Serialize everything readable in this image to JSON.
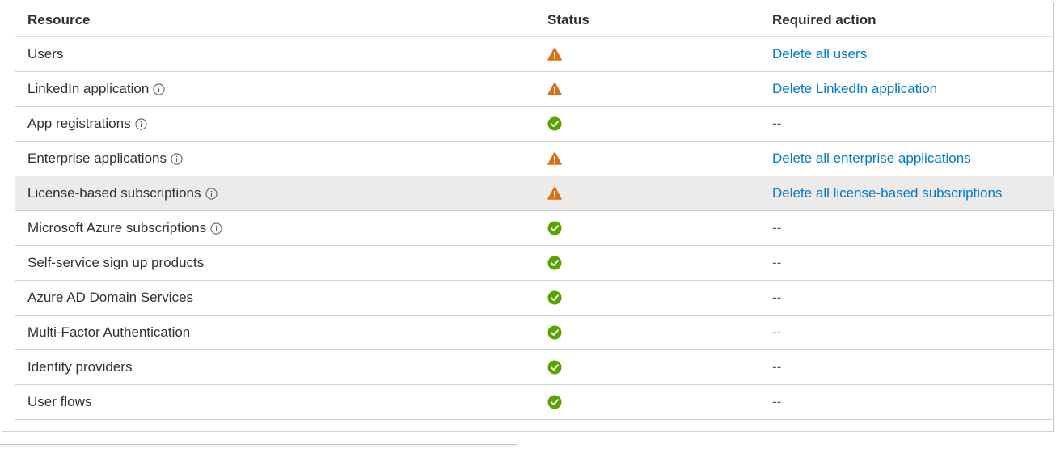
{
  "table": {
    "headers": {
      "resource": "Resource",
      "status": "Status",
      "action": "Required action"
    },
    "rows": [
      {
        "resource": "Users",
        "info": false,
        "status": "warning",
        "action": "Delete all users",
        "action_is_link": true
      },
      {
        "resource": "LinkedIn application",
        "info": true,
        "status": "warning",
        "action": "Delete LinkedIn application",
        "action_is_link": true
      },
      {
        "resource": "App registrations",
        "info": true,
        "status": "ok",
        "action": "--",
        "action_is_link": false
      },
      {
        "resource": "Enterprise applications",
        "info": true,
        "status": "warning",
        "action": "Delete all enterprise applications",
        "action_is_link": true
      },
      {
        "resource": "License-based subscriptions",
        "info": true,
        "status": "warning",
        "action": "Delete all license-based subscriptions",
        "action_is_link": true,
        "highlighted": true
      },
      {
        "resource": "Microsoft Azure subscriptions",
        "info": true,
        "status": "ok",
        "action": "--",
        "action_is_link": false
      },
      {
        "resource": "Self-service sign up products",
        "info": false,
        "status": "ok",
        "action": "--",
        "action_is_link": false
      },
      {
        "resource": "Azure AD Domain Services",
        "info": false,
        "status": "ok",
        "action": "--",
        "action_is_link": false
      },
      {
        "resource": "Multi-Factor Authentication",
        "info": false,
        "status": "ok",
        "action": "--",
        "action_is_link": false
      },
      {
        "resource": "Identity providers",
        "info": false,
        "status": "ok",
        "action": "--",
        "action_is_link": false
      },
      {
        "resource": "User flows",
        "info": false,
        "status": "ok",
        "action": "--",
        "action_is_link": false
      }
    ]
  },
  "icons": {
    "warning": "warning-triangle-icon",
    "ok": "checkmark-circle-icon",
    "info": "info-circle-icon"
  },
  "colors": {
    "warning": "#d97014",
    "ok": "#57a300",
    "link": "#0078d4",
    "highlight_row": "#edebe9"
  }
}
